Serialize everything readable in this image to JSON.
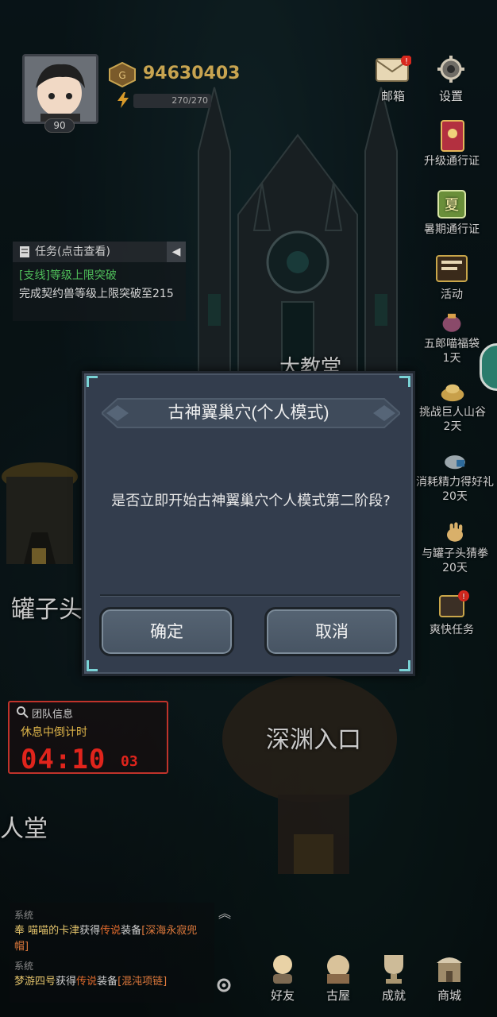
{
  "player": {
    "level": "90",
    "coins": "94630403",
    "energy": "270/270"
  },
  "top_buttons": {
    "mail_label": "邮箱",
    "mail_badge": "!",
    "settings_label": "设置"
  },
  "side_buttons": [
    {
      "label": "升级通行证",
      "days": ""
    },
    {
      "label": "暑期通行证",
      "days": ""
    },
    {
      "label": "活动",
      "days": ""
    },
    {
      "label": "五郎喵福袋",
      "days": "1天"
    },
    {
      "label": "挑战巨人山谷",
      "days": "2天"
    },
    {
      "label": "消耗精力得好礼",
      "days": "20天"
    },
    {
      "label": "与罐子头猜拳",
      "days": "20天"
    },
    {
      "label": "爽快任务",
      "days": ""
    }
  ],
  "task": {
    "header": "任务(点击查看)",
    "collapse": "◀",
    "line1": "[支线]等级上限突破",
    "line2": "完成契约兽等级上限突破至215"
  },
  "map": {
    "cathedral": "大教堂",
    "jar_head": "罐子头",
    "abyss": "深渊入口",
    "hall": "人堂"
  },
  "team": {
    "header": "团队信息",
    "status": "休息中倒计时",
    "time_main": "04:10",
    "time_small": "03"
  },
  "chat": {
    "msgs": [
      {
        "sys": "系统",
        "name": "奉 喵喵的卡津",
        "mid": "获得",
        "quality": "传说",
        "tail": "装备",
        "item": "[深海永寂兜帽]"
      },
      {
        "sys": "系统",
        "name": "梦游四号",
        "mid": "获得",
        "quality": "传说",
        "tail": "装备",
        "item": "[混沌项链]"
      }
    ],
    "up": "︽"
  },
  "bottom_nav": [
    {
      "label": "好友"
    },
    {
      "label": "古屋"
    },
    {
      "label": "成就"
    },
    {
      "label": "商城"
    }
  ],
  "dialog": {
    "title": "古神翼巢穴(个人模式)",
    "message": "是否立即开始古神翼巢穴个人模式第二阶段?",
    "confirm": "确定",
    "cancel": "取消"
  },
  "colors": {
    "dialog_bg": "#333d4d",
    "accent_cyan": "#7ad3d6",
    "task_green": "#4fbf5a",
    "timer_red": "#e0241c",
    "coin_gold": "#c8a450"
  },
  "icons": [
    "mail-icon",
    "gear-icon",
    "coin-icon",
    "bolt-icon",
    "document-icon",
    "magnifier-icon"
  ]
}
